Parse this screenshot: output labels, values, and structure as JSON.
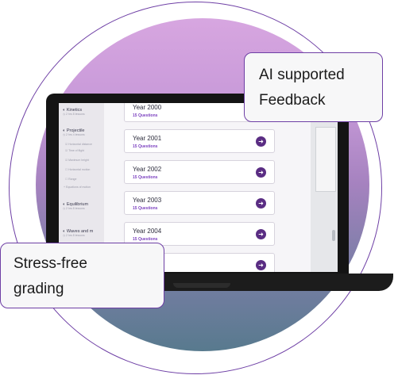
{
  "bubbles": {
    "ai_line1": "AI supported",
    "ai_line2": "Feedback",
    "stress_line1": "Stress-free",
    "stress_line2": "grading"
  },
  "sidebar": {
    "sections": [
      {
        "title": "Kinetics",
        "meta": "2 hrs   8 lessons"
      },
      {
        "title": "Projectile",
        "meta": "2 hrs   4 lessons"
      },
      {
        "title": "Equilibrium",
        "meta": "2 hrs   8 lessons"
      },
      {
        "title": "Waves and m",
        "meta": "2 hrs   8 lessons"
      }
    ],
    "items": [
      "Horizontal distance",
      "Time of flight",
      "Maximum height",
      "Horizontal motion",
      "Range"
    ],
    "footer": "Equations of motion"
  },
  "cards": [
    {
      "year": "Year 2000",
      "questions": "15 Questions"
    },
    {
      "year": "Year 2001",
      "questions": "15 Questions"
    },
    {
      "year": "Year 2002",
      "questions": "15 Questions"
    },
    {
      "year": "Year 2003",
      "questions": "15 Questions"
    },
    {
      "year": "Year 2004",
      "questions": "15 Questions"
    },
    {
      "year": "",
      "questions": ""
    }
  ],
  "icons": {
    "arrow": "arrow-right-icon",
    "clock": "clock-icon",
    "book": "book-icon",
    "check": "checkbox-icon"
  },
  "colors": {
    "accent": "#6e3fa5",
    "button": "#5a2d83",
    "questions": "#7a3fbf"
  }
}
